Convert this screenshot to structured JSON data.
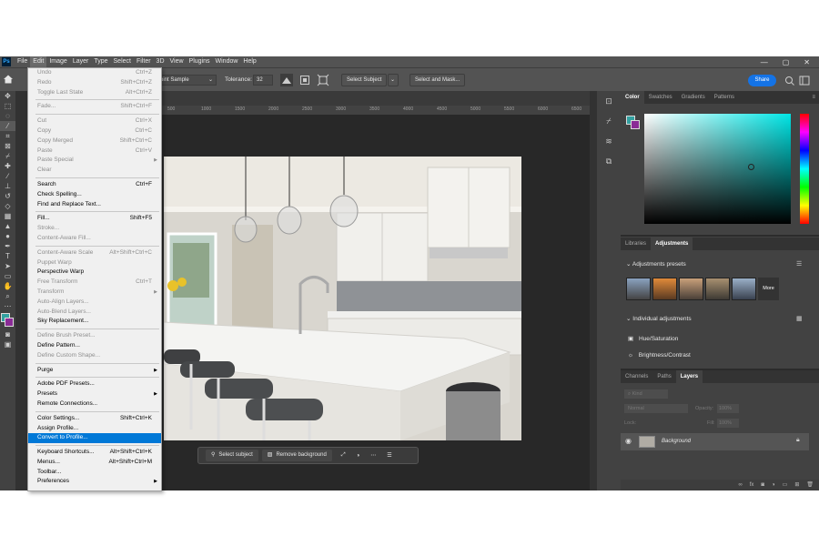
{
  "app": {
    "logo": "Ps"
  },
  "menubar": {
    "items": [
      "File",
      "Edit",
      "Image",
      "Layer",
      "Type",
      "Select",
      "Filter",
      "3D",
      "View",
      "Plugins",
      "Window",
      "Help"
    ],
    "window_controls": [
      "—",
      "▢",
      "✕"
    ]
  },
  "options_bar": {
    "sample_value": "oint Sample",
    "tolerance_label": "Tolerance:",
    "tolerance_value": "32",
    "select_subject": "Select Subject",
    "select_and_mask": "Select and Mask...",
    "share": "Share"
  },
  "ruler": {
    "marks": [
      "500",
      "1000",
      "1500",
      "2000",
      "2500",
      "3000",
      "3500",
      "4000",
      "4500",
      "5000",
      "5500",
      "6000",
      "6500"
    ]
  },
  "edit_menu": [
    {
      "label": "Undo",
      "shortcut": "Ctrl+Z",
      "disabled": true
    },
    {
      "label": "Redo",
      "shortcut": "Shift+Ctrl+Z",
      "disabled": true
    },
    {
      "label": "Toggle Last State",
      "shortcut": "Alt+Ctrl+Z",
      "disabled": true
    },
    {
      "sep": true
    },
    {
      "label": "Fade...",
      "shortcut": "Shift+Ctrl+F",
      "disabled": true
    },
    {
      "sep": true
    },
    {
      "label": "Cut",
      "shortcut": "Ctrl+X",
      "disabled": true
    },
    {
      "label": "Copy",
      "shortcut": "Ctrl+C",
      "disabled": true
    },
    {
      "label": "Copy Merged",
      "shortcut": "Shift+Ctrl+C",
      "disabled": true
    },
    {
      "label": "Paste",
      "shortcut": "Ctrl+V",
      "disabled": true
    },
    {
      "label": "Paste Special",
      "shortcut": "",
      "disabled": true,
      "submenu": true
    },
    {
      "label": "Clear",
      "shortcut": "",
      "disabled": true
    },
    {
      "sep": true
    },
    {
      "label": "Search",
      "shortcut": "Ctrl+F"
    },
    {
      "label": "Check Spelling...",
      "shortcut": ""
    },
    {
      "label": "Find and Replace Text...",
      "shortcut": ""
    },
    {
      "sep": true
    },
    {
      "label": "Fill...",
      "shortcut": "Shift+F5"
    },
    {
      "label": "Stroke...",
      "shortcut": "",
      "disabled": true
    },
    {
      "label": "Content-Aware Fill...",
      "shortcut": "",
      "disabled": true
    },
    {
      "sep": true
    },
    {
      "label": "Content-Aware Scale",
      "shortcut": "Alt+Shift+Ctrl+C",
      "disabled": true
    },
    {
      "label": "Puppet Warp",
      "shortcut": "",
      "disabled": true
    },
    {
      "label": "Perspective Warp",
      "shortcut": ""
    },
    {
      "label": "Free Transform",
      "shortcut": "Ctrl+T",
      "disabled": true
    },
    {
      "label": "Transform",
      "shortcut": "",
      "disabled": true,
      "submenu": true
    },
    {
      "label": "Auto-Align Layers...",
      "shortcut": "",
      "disabled": true
    },
    {
      "label": "Auto-Blend Layers...",
      "shortcut": "",
      "disabled": true
    },
    {
      "label": "Sky Replacement...",
      "shortcut": ""
    },
    {
      "sep": true
    },
    {
      "label": "Define Brush Preset...",
      "shortcut": "",
      "disabled": true
    },
    {
      "label": "Define Pattern...",
      "shortcut": ""
    },
    {
      "label": "Define Custom Shape...",
      "shortcut": "",
      "disabled": true
    },
    {
      "sep": true
    },
    {
      "label": "Purge",
      "shortcut": "",
      "submenu": true
    },
    {
      "sep": true
    },
    {
      "label": "Adobe PDF Presets...",
      "shortcut": ""
    },
    {
      "label": "Presets",
      "shortcut": "",
      "submenu": true
    },
    {
      "label": "Remote Connections...",
      "shortcut": ""
    },
    {
      "sep": true
    },
    {
      "label": "Color Settings...",
      "shortcut": "Shift+Ctrl+K"
    },
    {
      "label": "Assign Profile...",
      "shortcut": ""
    },
    {
      "label": "Convert to Profile...",
      "shortcut": "",
      "highlighted": true
    },
    {
      "sep": true
    },
    {
      "label": "Keyboard Shortcuts...",
      "shortcut": "Alt+Shift+Ctrl+K"
    },
    {
      "label": "Menus...",
      "shortcut": "Alt+Shift+Ctrl+M"
    },
    {
      "label": "Toolbar...",
      "shortcut": ""
    },
    {
      "label": "Preferences",
      "shortcut": "",
      "submenu": true
    }
  ],
  "taskbar": {
    "select_subject": "Select subject",
    "remove_background": "Remove background"
  },
  "panels": {
    "color_tabs": [
      "Color",
      "Swatches",
      "Gradients",
      "Patterns"
    ],
    "adj_tabs": [
      "Libraries",
      "Adjustments"
    ],
    "adjustments_presets": "Adjustments presets",
    "more": "More",
    "individual_adjustments": "Individual adjustments",
    "adj_items": [
      "Hue/Saturation",
      "Brightness/Contrast"
    ],
    "layer_tabs": [
      "Channels",
      "Paths",
      "Layers"
    ],
    "kind": "Kind",
    "blend": "Normal",
    "opacity_label": "Opacity:",
    "opacity_value": "100%",
    "lock_label": "Lock:",
    "fill_label": "Fill:",
    "fill_value": "100%",
    "layer_name": "Background"
  },
  "colors": {
    "accent": "#1473e6",
    "highlight": "#0078d7",
    "fg_swatch": "#33a1a1",
    "bg_swatch": "#8a2b96"
  }
}
